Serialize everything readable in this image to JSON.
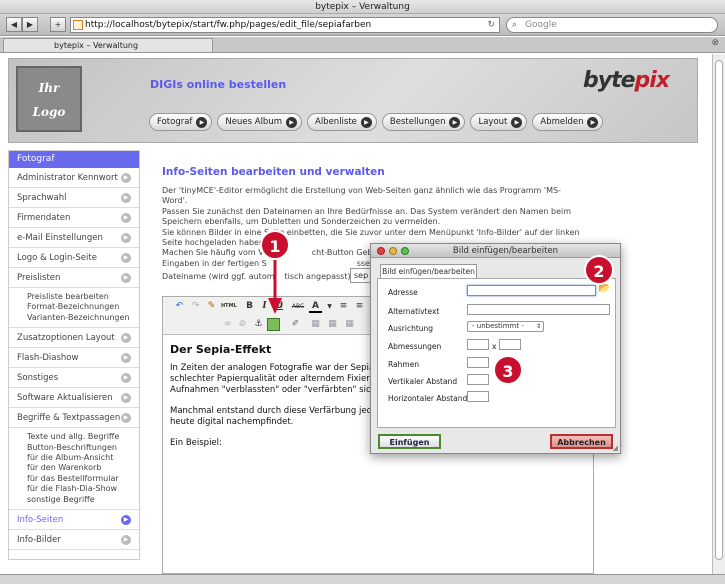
{
  "window": {
    "title": "bytepix – Verwaltung"
  },
  "browser": {
    "url": "http://localhost/bytepix/start/fw.php/pages/edit_file/sepiafarben",
    "search_placeholder": "Google",
    "tab_title": "bytepix – Verwaltung"
  },
  "header": {
    "logo_line1": "Ihr",
    "logo_line2": "Logo",
    "tagline": "DIGIs online bestellen",
    "brand_a": "byte",
    "brand_b": "pix",
    "nav": [
      "Fotograf",
      "Neues Album",
      "Albenliste",
      "Bestellungen",
      "Layout",
      "Abmelden"
    ]
  },
  "sidebar": {
    "heading": "Fotograf",
    "items": [
      {
        "label": "Administrator Kennwort"
      },
      {
        "label": "Sprachwahl"
      },
      {
        "label": "Firmendaten"
      },
      {
        "label": "e-Mail Einstellungen"
      },
      {
        "label": "Logo & Login-Seite"
      },
      {
        "label": "Preislisten"
      }
    ],
    "preis_sub": [
      "Preisliste bearbeiten",
      "Format-Bezeichnungen",
      "Varianten-Bezeichnungen"
    ],
    "items2": [
      {
        "label": "Zusatzoptionen Layout"
      },
      {
        "label": "Flash-Diashow"
      },
      {
        "label": "Sonstiges"
      },
      {
        "label": "Software Aktualisieren"
      },
      {
        "label": "Begriffe & Textpassagen"
      }
    ],
    "begriffe_sub": [
      "Texte und allg. Begriffe",
      "Button-Beschriftungen",
      "für die Album-Ansicht",
      "für den Warenkorb",
      "für das Bestellformular",
      "für die Flash-Dia-Show",
      "sonstige Begriffe"
    ],
    "active": "Info-Seiten",
    "last": "Info-Bilder"
  },
  "main": {
    "title": "Info-Seiten bearbeiten und verwalten",
    "intro": [
      "Der 'tinyMCE'-Editor ermöglicht die Erstellung von Web-Seiten ganz ähnlich wie das Programm 'MS-",
      "Word'.",
      "Passen Sie zunächst den Dateinamen an Ihre Bedürfnisse an. Das System verändert den Namen beim",
      "Speichern ebenfalls, um Dubletten und Sonderzeichen zu vermeiden.",
      "Sie können Bilder in eine Seite einbetten, die Sie zuvor unter dem Menüpunkt 'Info-Bilder' auf der linken",
      "Seite hochgeladen haben.",
      "Machen Sie häufig vom V",
      "Eingaben in der fertigen S"
    ],
    "intro_tail_a": "cht-Button Gebrauch",
    "intro_tail_b": "ssehen.",
    "filename_label": "Dateiname (wird ggf. autom",
    "filename_label_tail": "tisch angepasst):",
    "filename_value": "sep"
  },
  "editor": {
    "heading": "Der Sepia-Effekt",
    "p1": [
      "In Zeiten der analogen Fotografie war der Sepia-",
      "schlechter Papierqualität oder alterndem Fixierer",
      "Aufnahmen \"verblassten\" oder \"verfärbten\" sich"
    ],
    "p2": [
      "Manchmal entstand durch diese Verfärbung jedo",
      "heute digital nachempfindet."
    ],
    "p3": "Ein Beispiel:",
    "tools": {
      "bold": "B",
      "italic": "I",
      "underline": "U",
      "abc": "ABC",
      "font_a": "A",
      "html": "HTML"
    }
  },
  "dialog": {
    "title": "Bild einfügen/bearbeiten",
    "tab": "Bild einfügen/bearbeiten",
    "labels": {
      "adresse": "Adresse",
      "alt": "Alternativtext",
      "ausrichtung": "Ausrichtung",
      "abmessungen": "Abmessungen",
      "rahmen": "Rahmen",
      "vabstand": "Vertikaler Abstand",
      "habstand": "Horizontaler Abstand"
    },
    "align_value": "- unbestimmt -",
    "dim_sep": "x",
    "insert": "Einfügen",
    "cancel": "Abbrechen"
  },
  "callouts": [
    "1",
    "2",
    "3"
  ],
  "colors": {
    "accent": "#6a6aee",
    "red": "#c8102e"
  }
}
